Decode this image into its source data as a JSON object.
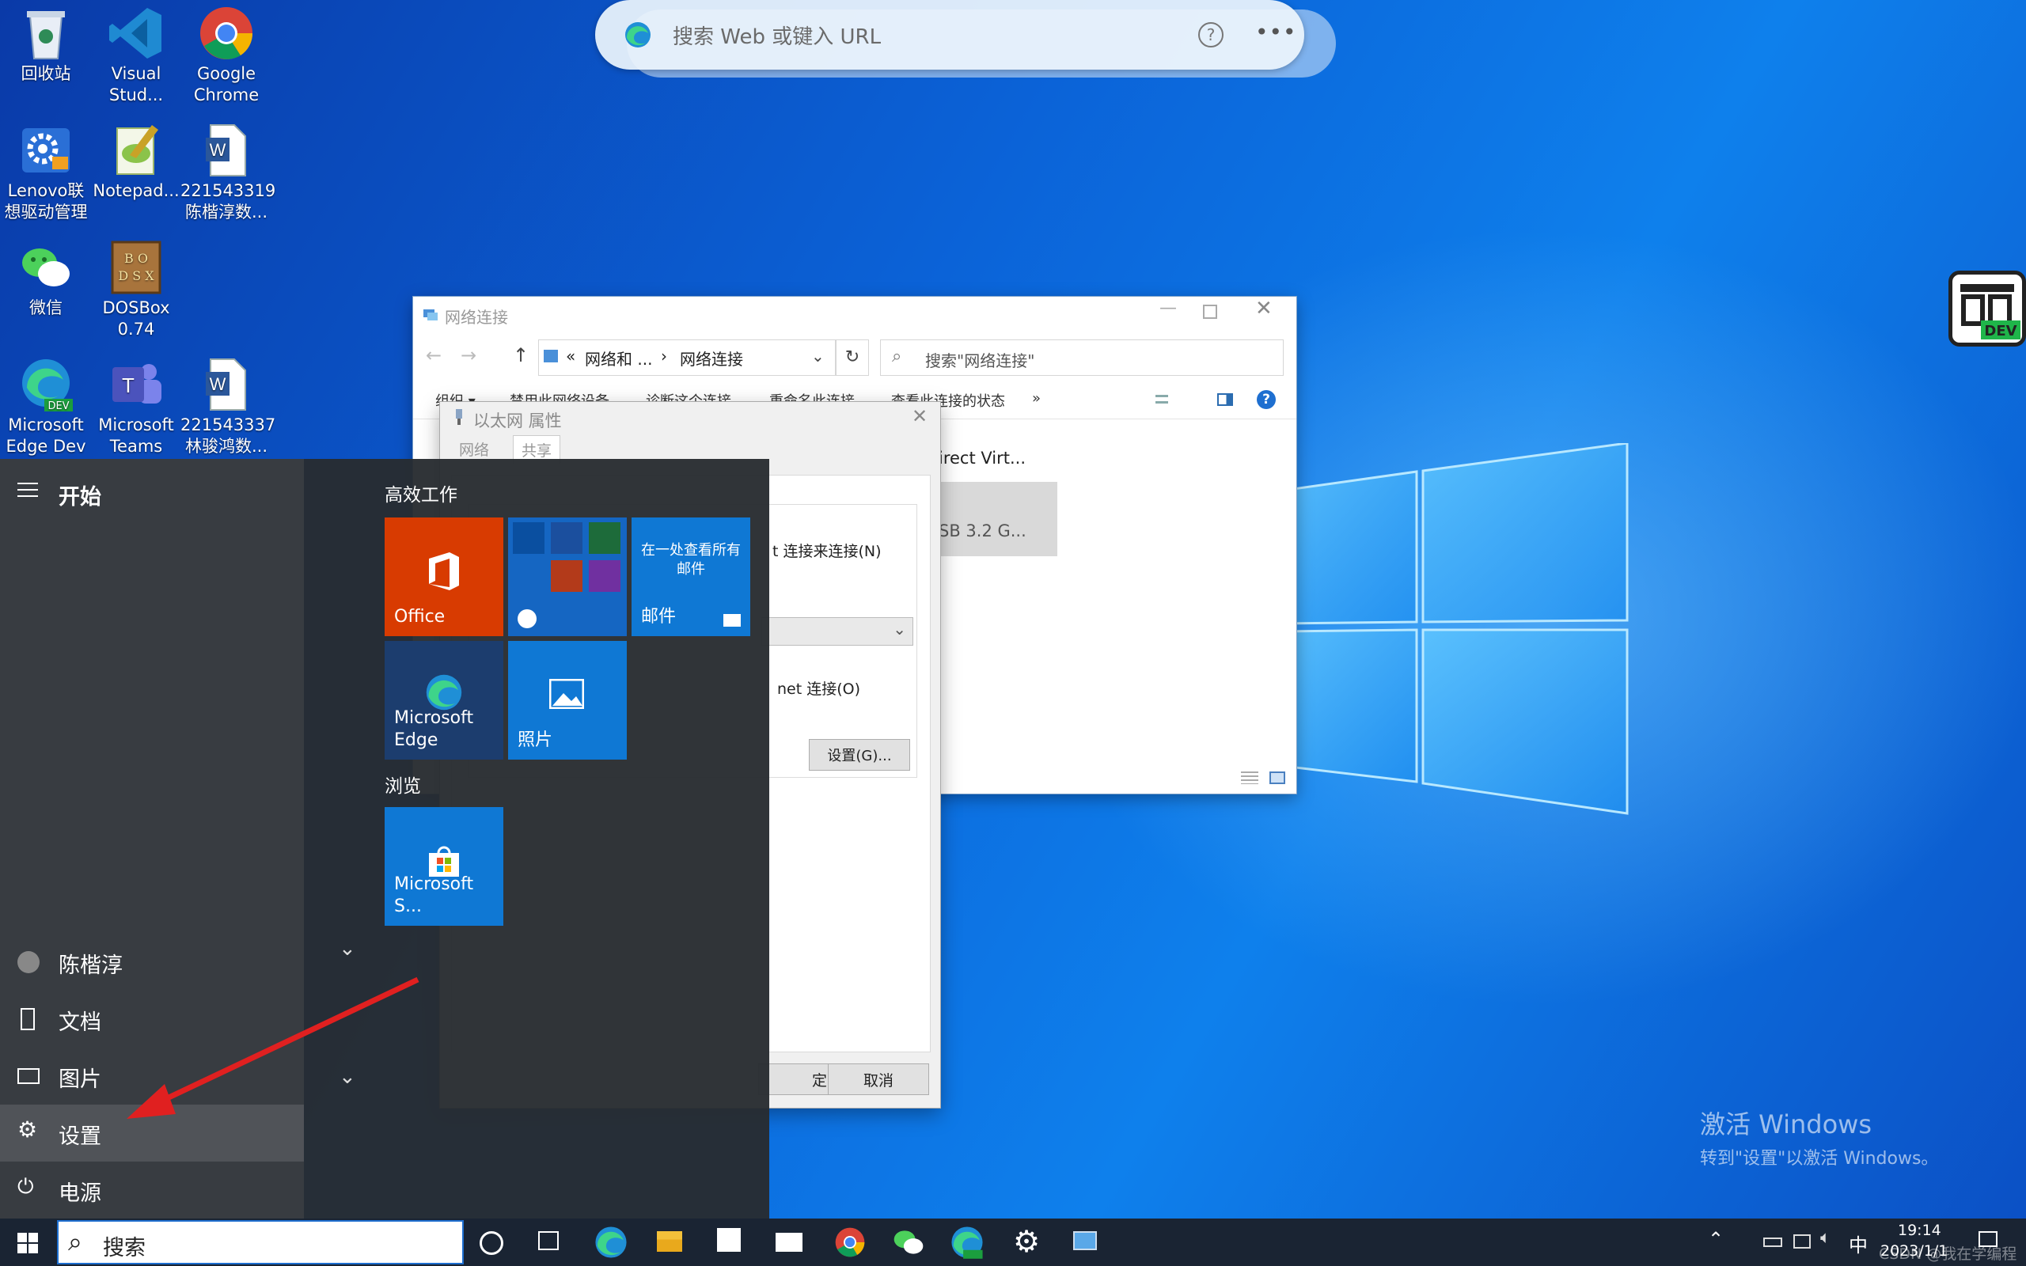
{
  "desktop": {
    "icons": [
      {
        "label": "回收站"
      },
      {
        "label": "Visual\nStud..."
      },
      {
        "label": "Google\nChrome"
      },
      {
        "label": "Lenovo联\n想驱动管理"
      },
      {
        "label": "Notepad..."
      },
      {
        "label": "221543319\n陈楷淳数..."
      },
      {
        "label": "微信"
      },
      {
        "label": "DOSBox\n0.74"
      },
      {
        "label": "Microsoft\nEdge Dev"
      },
      {
        "label": "Microsoft\nTeams"
      },
      {
        "label": "221543337\n林骏鸿数..."
      }
    ],
    "badge_dev": "DEV"
  },
  "edge_bar": {
    "placeholder": "搜索 Web 或键入 URL"
  },
  "explorer": {
    "title": "网络连接",
    "breadcrumb": [
      "«",
      "网络和 ...",
      "›",
      "网络连接"
    ],
    "search_placeholder": "搜索\"网络连接\"",
    "commands": [
      "组织 ▾",
      "禁用此网络设备",
      "诊断这个连接",
      "重命名此连接",
      "查看此连接的状态",
      "»"
    ],
    "adapter_lines": [
      "irect Virt...",
      "SB 3.2 G..."
    ]
  },
  "dialog": {
    "title": "以太网 属性",
    "tabs": [
      "网络",
      "共享"
    ],
    "line1": "t 连接来连接(N)",
    "line2": "net 连接(O)",
    "settings_button": "设置(G)...",
    "ok_button": "定",
    "cancel_button": "取消"
  },
  "start_menu": {
    "header": "开始",
    "group1": "高效工作",
    "group2": "浏览",
    "tiles": {
      "office": "Office",
      "mail_caption": "在一处查看所有邮件",
      "mail": "邮件",
      "edge": "Microsoft\nEdge",
      "photos": "照片",
      "store": "Microsoft S..."
    },
    "nav": {
      "user": "陈楷淳",
      "documents": "文档",
      "pictures": "图片",
      "settings": "设置",
      "power": "电源"
    }
  },
  "taskbar": {
    "search_placeholder": "搜索",
    "ime": "中",
    "time": "19:14",
    "date": "2023/1/1",
    "overlay_text": "CSDN @我在学编程"
  },
  "watermark": {
    "line1": "激活 Windows",
    "line2": "转到\"设置\"以激活 Windows。"
  },
  "colors": {
    "accent": "#0078d7",
    "office_tile": "#d83b01",
    "arrow": "#e02020"
  }
}
